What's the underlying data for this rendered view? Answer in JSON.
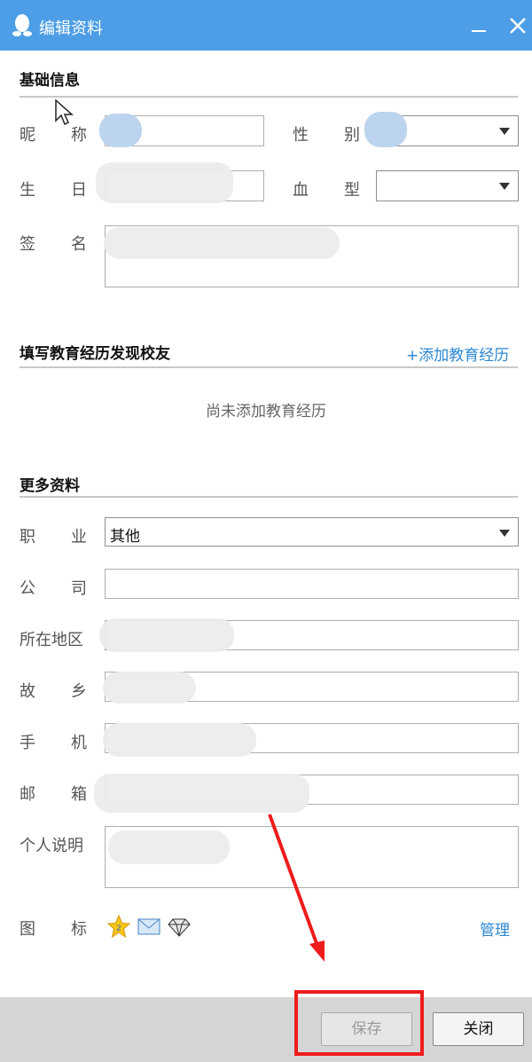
{
  "window": {
    "title": "编辑资料",
    "logo_icon": "qq-penguin-icon",
    "minimize_icon": "minimize-icon",
    "close_icon": "close-icon"
  },
  "basic": {
    "section_title": "基础信息",
    "nickname_label": [
      "昵",
      "称"
    ],
    "gender_label": [
      "性",
      "别"
    ],
    "birthday_label": [
      "生",
      "日"
    ],
    "blood_label": [
      "血",
      "型"
    ],
    "signature_label": [
      "签",
      "名"
    ]
  },
  "education": {
    "section_title": "填写教育经历发现校友",
    "add_link": "+添加教育经历",
    "empty_text": "尚未添加教育经历"
  },
  "more": {
    "section_title": "更多资料",
    "job_label": [
      "职",
      "业"
    ],
    "job_value": "其他",
    "company_label": [
      "公",
      "司"
    ],
    "location_label": "所在地区",
    "hometown_label": [
      "故",
      "乡"
    ],
    "phone_label": [
      "手",
      "机"
    ],
    "email_label": [
      "邮",
      "箱"
    ],
    "bio_label": "个人说明",
    "icons_label": [
      "图",
      "标"
    ],
    "icons": [
      "star-badge-icon",
      "mail-icon",
      "diamond-icon"
    ],
    "manage_link": "管理"
  },
  "footer": {
    "save_label": "保存",
    "close_label": "关闭"
  },
  "colors": {
    "titlebar": "#4d9ee6",
    "link": "#2b87d3",
    "highlight": "#ee1c1c"
  }
}
